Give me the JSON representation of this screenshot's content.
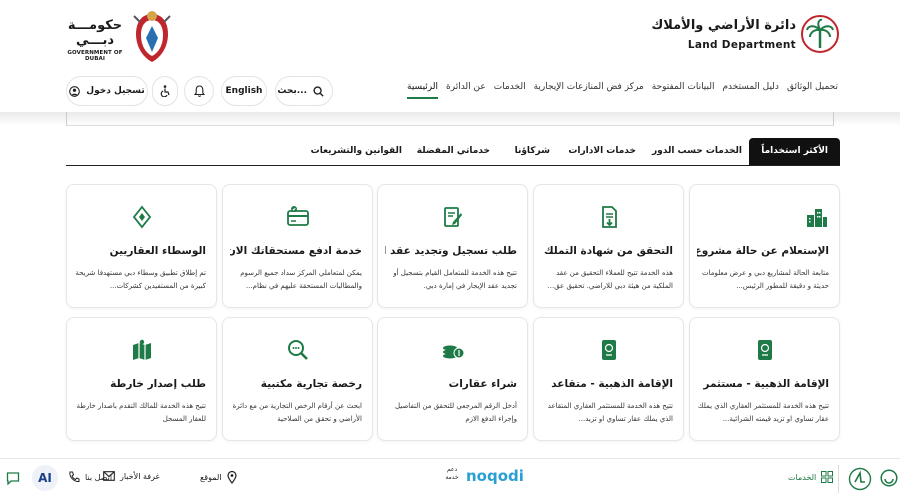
{
  "logos": {
    "dubai_ar": "حكومـــة دبـــي",
    "dubai_en": "GOVERNMENT OF DUBAI",
    "dld_ar": "دائرة الأراضي والأملاك",
    "dld_en": "Land Department"
  },
  "toolbar": {
    "login": "تسجيل دخول",
    "language": "English",
    "search_placeholder": "بحث..."
  },
  "nav": [
    "الرئيسية",
    "عن الدائرة",
    "الخدمات",
    "مركز فض المنازعات الإيجارية",
    "البيانات المفتوحة",
    "دليل المستخدم",
    "تحميل الوثائق"
  ],
  "tabs": [
    "الأكثر استخداماً",
    "الخدمات حسب الدور",
    "خدمات الادارات",
    "شركاؤنا",
    "خدماتي المفضلة",
    "القوانين والتشريعات"
  ],
  "cards": [
    {
      "title": "الإستعلام عن حالة مشروع عقاري",
      "desc": "متابعة الحالة لمشاريع دبي و عرض معلومات حديثة و دقيقة للمطور الرئيس...",
      "icon": "buildings-icon"
    },
    {
      "title": "التحقق من شهادة التملك",
      "desc": "هذه الخدمة تتيح للعملاء التحقيق من عقد الملكية من هيئة دبي للاراضي. تحقيق عق...",
      "icon": "document-download-icon"
    },
    {
      "title": "طلب تسجيل وتجديد عقد الإيجار",
      "desc": "تتيح هذه الخدمة للمتعامل القيام بتسجيل أو تجديد عقد الإيجار في إمارة دبي.",
      "icon": "contract-pen-icon"
    },
    {
      "title": "خدمة ادفع مستحقاتك الان",
      "desc": "يمكن لمتعاملي المركز سداد جميع الرسوم والمطالبات المستحقة عليهم في نظام...",
      "icon": "payment-card-icon"
    },
    {
      "title": "الوسطاء العقاريين",
      "desc": "تم إطلاق تطبيق وسطاء دبي مستهدفا شريحة كبيرة من المستفيدين كشركات...",
      "icon": "diamond-icon"
    },
    {
      "title": "الإقامة الذهبية - مستثمر",
      "desc": "تتيح هذه الخدمة للمستثمر العقاري الذي يملك عقار تساوي او تزيد قيمته الشرائية...",
      "icon": "passport-icon"
    },
    {
      "title": "الإقامة الذهبية - متقاعد",
      "desc": "تتيح هذه الخدمة للمستثمر العقاري المتقاعد الذي يملك عقار تساوي او تزيد...",
      "icon": "passport-icon"
    },
    {
      "title": "شراء عقارات",
      "desc": "أدخل الرقم المرجعي للتحقق من التفاصيل وإجراء الدفع الازم",
      "icon": "coins-icon"
    },
    {
      "title": "رخصة تجارية مكتبية",
      "desc": "ابحث عن أرقام الرخص التجارية من مع دائرة الأراضي و تحقق من الصلاحية",
      "icon": "magnifier-icon"
    },
    {
      "title": "طلب إصدار خارطة",
      "desc": "تتيح هذه الخدمة للمالك التقدم باصدار خارطة للعقار المسجل",
      "icon": "map-icon"
    }
  ],
  "footer": {
    "services": "الخدمات",
    "location": "الموقع",
    "newsroom": "غرفة الأخبار",
    "contact": "اتصل بنا",
    "ai": "AI",
    "noqodi": "noqodi",
    "noqodi_ar": "دعم خدمة"
  },
  "colors": {
    "accent": "#1e7a46",
    "dark": "#111111",
    "red": "#c0272d"
  }
}
